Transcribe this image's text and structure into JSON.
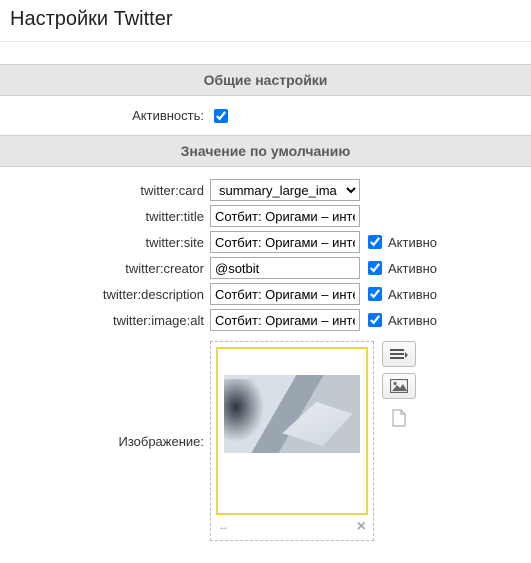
{
  "page_title": "Настройки Twitter",
  "sections": {
    "general": {
      "header": "Общие настройки",
      "activity_label": "Активность:",
      "activity_checked": true
    },
    "defaults": {
      "header": "Значение по умолчанию",
      "active_label": "Активно",
      "fields": {
        "card": {
          "label": "twitter:card",
          "value": "summary_large_ima"
        },
        "title": {
          "label": "twitter:title",
          "value": "Сотбит: Оригами – интерне"
        },
        "site": {
          "label": "twitter:site",
          "value": "Сотбит: Оригами – интерне",
          "active": true
        },
        "creator": {
          "label": "twitter:creator",
          "value": "@sotbit",
          "active": true
        },
        "description": {
          "label": "twitter:description",
          "value": "Сотбит: Оригами – интерне",
          "active": true
        },
        "image_alt": {
          "label": "twitter:image:alt",
          "value": "Сотбит: Оригами – интерне",
          "active": true
        },
        "image": {
          "label": "Изображение:"
        }
      }
    }
  }
}
